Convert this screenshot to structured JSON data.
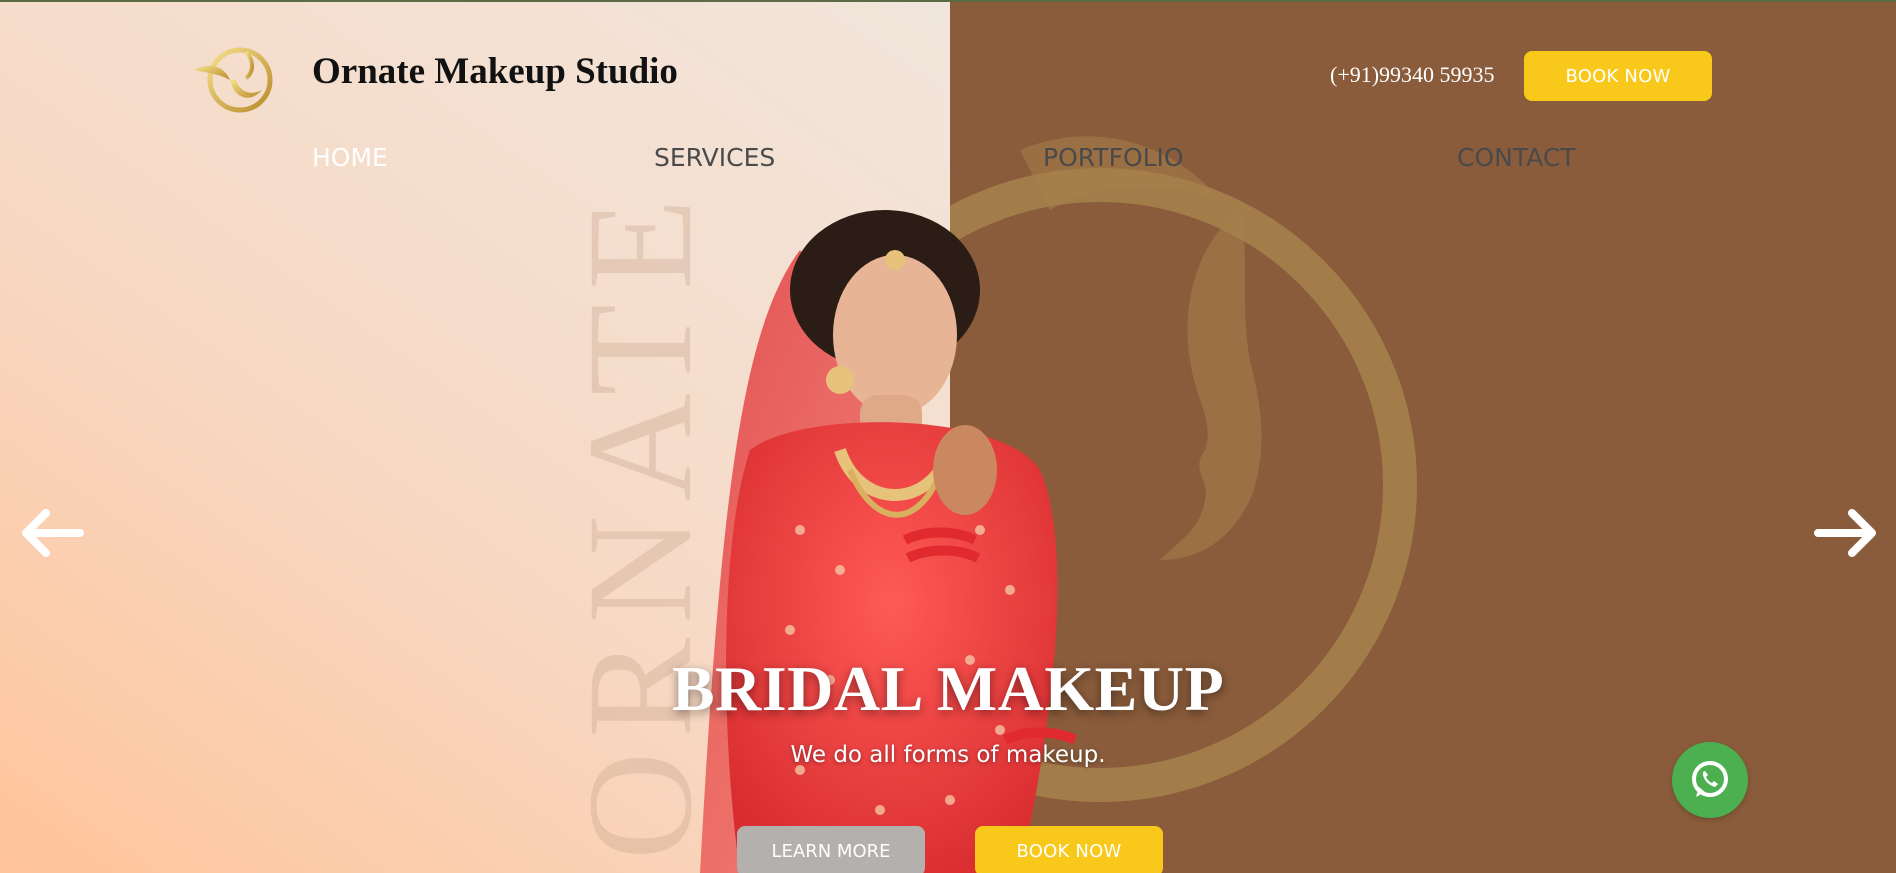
{
  "header": {
    "brand_name": "Ornate Makeup Studio",
    "phone": "(+91)99340 59935",
    "book_now_label": "BOOK NOW"
  },
  "nav": {
    "items": [
      {
        "label": "HOME",
        "active": true
      },
      {
        "label": "SERVICES",
        "active": false
      },
      {
        "label": "PORTFOLIO",
        "active": false
      },
      {
        "label": "CONTACT",
        "active": false
      }
    ]
  },
  "hero": {
    "watermark_text": "ORNATE",
    "title": "BRIDAL MAKEUP",
    "subtitle": "We do all forms of makeup.",
    "learn_more_label": "LEARN MORE",
    "book_now_label": "BOOK NOW"
  },
  "icons": {
    "logo": "ornate-logo",
    "prev": "arrow-left-icon",
    "next": "arrow-right-icon",
    "chat": "whatsapp-icon"
  },
  "colors": {
    "accent_yellow": "#f8c81a",
    "brown_panel": "#8a5c3b",
    "peach_panel": "#ffc49a",
    "muted_button": "#b4b0ad",
    "whatsapp_green": "#4caf50"
  }
}
